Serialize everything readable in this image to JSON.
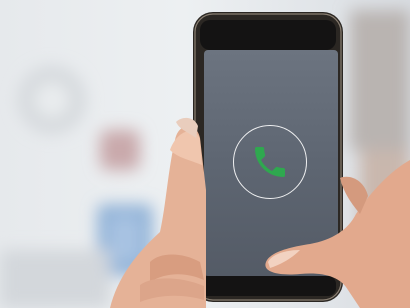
{
  "scene": {
    "background_color": "#dfe3e8",
    "phone_frame_color": "#2b2723",
    "screen_color": "#5e6672",
    "skin_color": "#e7b79e"
  },
  "call_screen": {
    "icon": "phone-handset-icon",
    "icon_color": "#2fa84f",
    "ring_color": "#ffffff"
  }
}
